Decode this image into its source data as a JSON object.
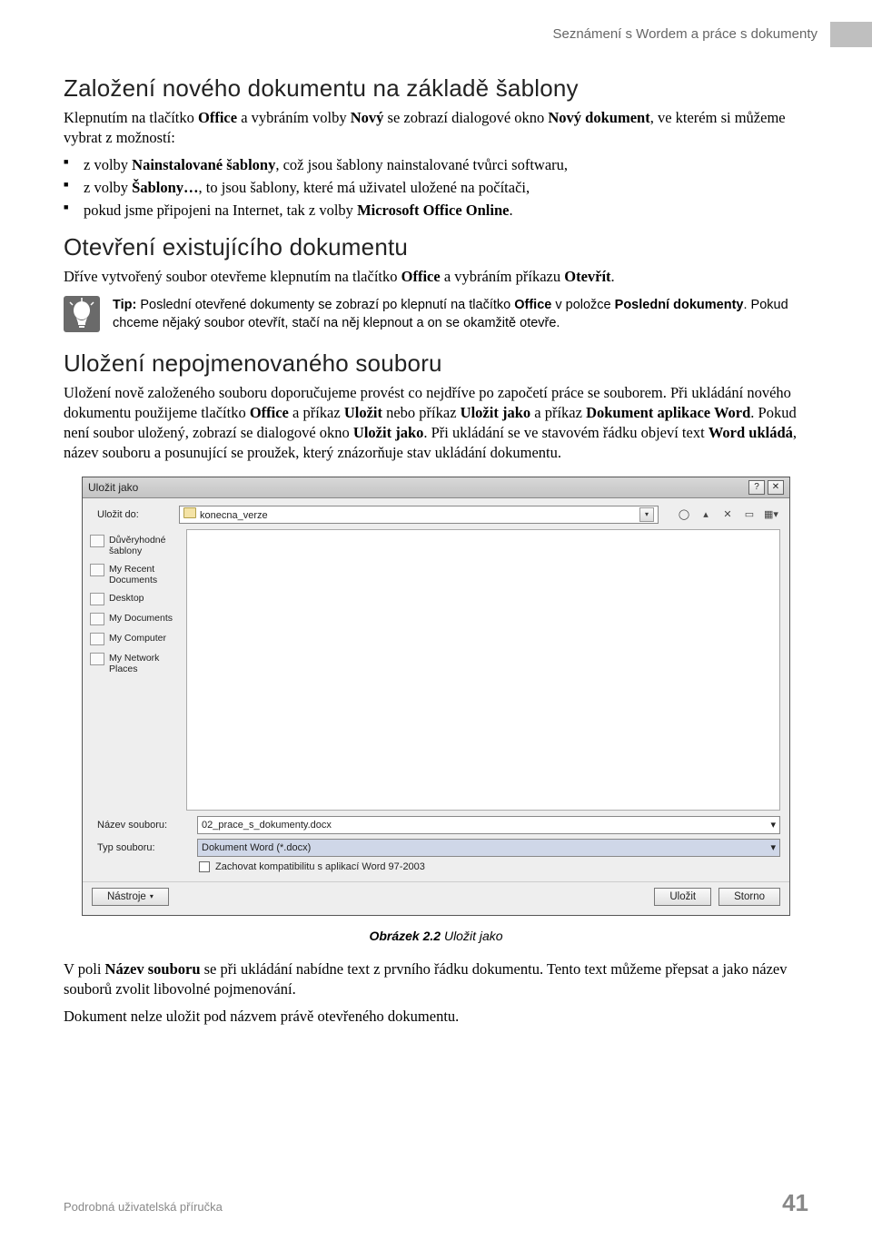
{
  "header": {
    "title": "Seznámení s Wordem a práce s dokumenty"
  },
  "section1": {
    "heading": "Založení nového dokumentu na základě šablony",
    "intro_a": "Klepnutím na tlačítko ",
    "intro_b": "Office",
    "intro_c": " a vybráním volby ",
    "intro_d": "Nový",
    "intro_e": " se zobrazí dialogové okno ",
    "intro_f": "Nový dokument",
    "intro_g": ", ve kterém si můžeme vybrat z možností:",
    "bullets": [
      {
        "a": "z volby ",
        "b": "Nainstalované šablony",
        "c": ", což jsou šablony nainstalované tvůrci softwaru,"
      },
      {
        "a": "z volby ",
        "b": "Šablony…",
        "c": ", to jsou šablony, které má uživatel uložené na počítači,"
      },
      {
        "a": "pokud jsme připojeni na Internet, tak z volby ",
        "b": "Microsoft Office Online",
        "c": "."
      }
    ]
  },
  "section2": {
    "heading": "Otevření existujícího dokumentu",
    "p_a": "Dříve vytvořený soubor otevřeme klepnutím na tlačítko ",
    "p_b": "Office",
    "p_c": " a vybráním příkazu ",
    "p_d": "Otevřít",
    "p_e": "."
  },
  "tip": {
    "label": "Tip:",
    "a": " Poslední otevřené dokumenty se zobrazí po klepnutí na tlačítko ",
    "b": "Office",
    "c": " v položce ",
    "d": "Poslední dokumenty",
    "e": ". Pokud chceme nějaký soubor otevřít, stačí na něj klepnout a on se okamžitě otevře."
  },
  "section3": {
    "heading": "Uložení nepojmenovaného souboru",
    "p1_a": "Uložení nově založeného souboru doporučujeme provést co nejdříve po započetí práce se souborem. Při ukládání nového dokumentu použijeme tlačítko ",
    "p1_b": "Office",
    "p1_c": " a příkaz ",
    "p1_d": "Uložit",
    "p1_e": " nebo příkaz ",
    "p1_f": "Uložit jako",
    "p1_g": " a příkaz ",
    "p1_h": "Dokument aplikace Word",
    "p1_i": ". Pokud není soubor uložený, zobrazí se dialogové okno ",
    "p1_j": "Uložit jako",
    "p1_k": ". Při ukládání se ve stavovém řádku objeví text ",
    "p1_l": "Word ukládá",
    "p1_m": ", název souboru a posunující se proužek, který znázorňuje stav ukládání dokumentu."
  },
  "dialog": {
    "title": "Uložit jako",
    "save_in_label": "Uložit do:",
    "save_in_value": "konecna_verze",
    "sidebar": [
      "Důvěryhodné šablony",
      "My Recent Documents",
      "Desktop",
      "My Documents",
      "My Computer",
      "My Network Places"
    ],
    "filename_label": "Název souboru:",
    "filename_value": "02_prace_s_dokumenty.docx",
    "filetype_label": "Typ souboru:",
    "filetype_value": "Dokument Word (*.docx)",
    "compat_label": "Zachovat kompatibilitu s aplikací Word 97-2003",
    "tools_btn": "Nástroje",
    "save_btn": "Uložit",
    "cancel_btn": "Storno"
  },
  "figure": {
    "num": "Obrázek 2.2",
    "caption": " Uložit jako"
  },
  "para_after": {
    "a": "V poli ",
    "b": "Název souboru",
    "c": " se při ukládání nabídne text z prvního řádku dokumentu. Tento text můžeme přepsat a jako název souborů zvolit libovolné pojmenování."
  },
  "para_last": "Dokument nelze uložit pod názvem právě otevřeného dokumentu.",
  "footer": {
    "left": "Podrobná uživatelská příručka",
    "page": "41"
  }
}
